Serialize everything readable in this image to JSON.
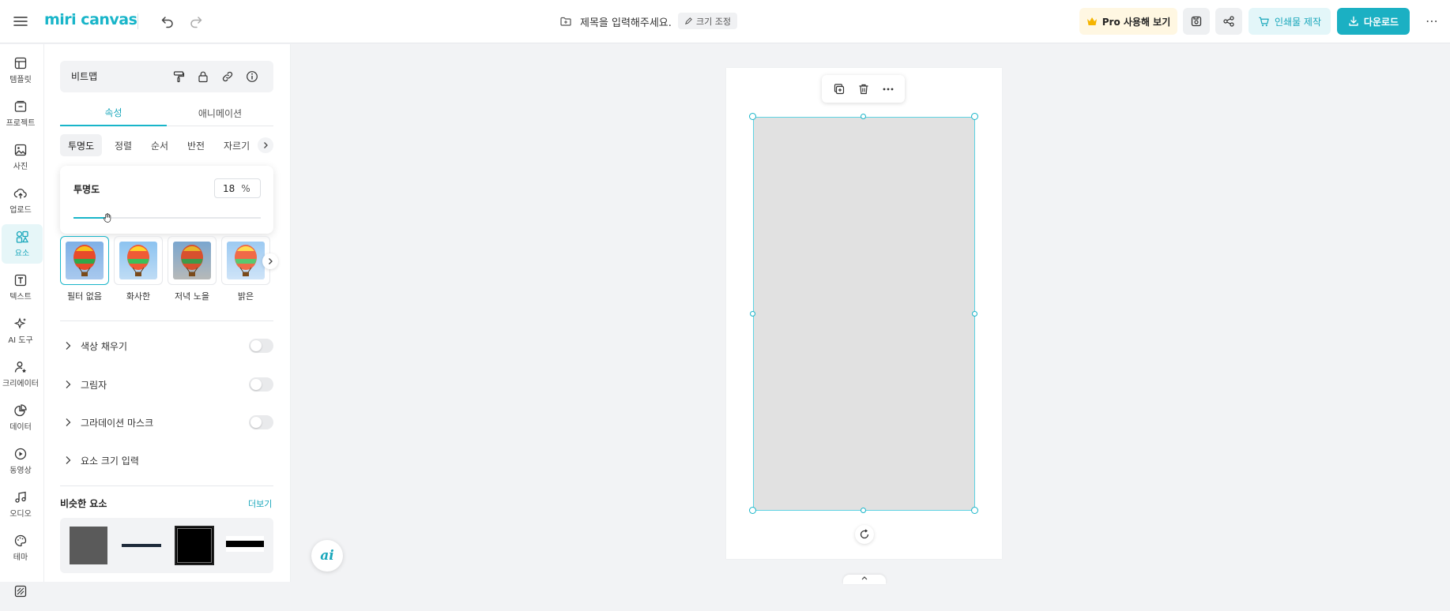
{
  "header": {
    "logo": "miri canvas",
    "doc_title_placeholder": "제목을 입력해주세요.",
    "resize_label": "크기 조정",
    "pro_label": "Pro 사용해 보기",
    "print_label": "인쇄물 제작",
    "download_label": "다운로드",
    "accent_color": "#1bb0c3"
  },
  "rail": {
    "items": [
      {
        "label": "템플릿",
        "icon": "template-icon"
      },
      {
        "label": "프로젝트",
        "icon": "project-icon"
      },
      {
        "label": "사진",
        "icon": "photo-icon"
      },
      {
        "label": "업로드",
        "icon": "upload-icon"
      },
      {
        "label": "요소",
        "icon": "elements-icon",
        "active": true
      },
      {
        "label": "텍스트",
        "icon": "text-icon"
      },
      {
        "label": "AI 도구",
        "icon": "ai-tools-icon"
      },
      {
        "label": "크리에이터",
        "icon": "creator-icon"
      },
      {
        "label": "데이터",
        "icon": "data-icon"
      },
      {
        "label": "동영상",
        "icon": "video-icon"
      },
      {
        "label": "오디오",
        "icon": "audio-icon"
      },
      {
        "label": "테마",
        "icon": "theme-icon"
      }
    ]
  },
  "panel": {
    "element_name": "비트맵",
    "tabs": [
      {
        "label": "속성",
        "active": true
      },
      {
        "label": "애니메이션",
        "active": false
      }
    ],
    "subtabs": [
      {
        "label": "투명도",
        "active": true
      },
      {
        "label": "정렬"
      },
      {
        "label": "순서"
      },
      {
        "label": "반전"
      },
      {
        "label": "자르기"
      }
    ],
    "opacity": {
      "label": "투명도",
      "value": "18",
      "unit": "%",
      "fraction": 0.18
    },
    "filters": [
      {
        "label": "필터 없음",
        "active": true
      },
      {
        "label": "화사한"
      },
      {
        "label": "저녁 노을"
      },
      {
        "label": "밝은"
      }
    ],
    "accordions": [
      {
        "label": "색상 채우기",
        "toggle": false
      },
      {
        "label": "그림자",
        "toggle": false
      },
      {
        "label": "그라데이션 마스크",
        "toggle": false
      },
      {
        "label": "요소 크기 입력"
      }
    ],
    "similar": {
      "title": "비슷한 요소",
      "more_label": "더보기"
    }
  },
  "canvas": {
    "ai_label": "ai",
    "selection_color": "#19b5c9",
    "bitmap_fill": "#e1e1e1"
  }
}
